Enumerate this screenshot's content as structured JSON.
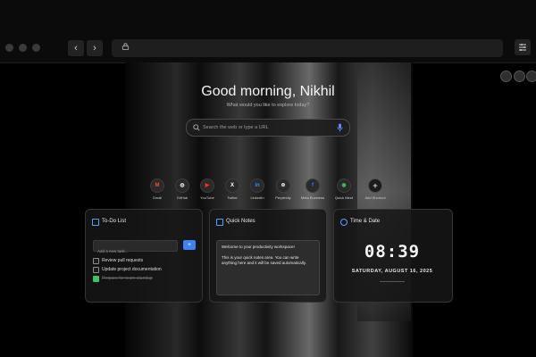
{
  "browser": {
    "back_icon": "chevron-left-icon",
    "forward_icon": "chevron-right-icon",
    "url_value": "",
    "lock_icon": "lock-icon",
    "menu_icon": "sliders-icon"
  },
  "top_right_icons": [
    "settings-icon",
    "globe-icon",
    "refresh-icon"
  ],
  "hero": {
    "greeting": "Good morning, Nikhil",
    "subtitle": "What would you like to explore today?"
  },
  "search": {
    "placeholder": "Search the web or type a URL",
    "icon": "search-icon",
    "mic_icon": "mic-icon",
    "accent": "#5a8dff"
  },
  "shortcuts": [
    {
      "label": "Gmail",
      "glyph": "M",
      "color": "#e84b3c"
    },
    {
      "label": "GitHub",
      "glyph": "◍",
      "color": "#d8d8d8"
    },
    {
      "label": "YouTube",
      "glyph": "▶",
      "color": "#ff2a2a"
    },
    {
      "label": "Twitter",
      "glyph": "X",
      "color": "#ffffff"
    },
    {
      "label": "LinkedIn",
      "glyph": "in",
      "color": "#2e8cff"
    },
    {
      "label": "Perplexity",
      "glyph": "⊛",
      "color": "#dcdcdc"
    },
    {
      "label": "Meta Business",
      "glyph": "f",
      "color": "#3b74ff"
    },
    {
      "label": "Quick Meet",
      "glyph": "◉",
      "color": "#3bbf62"
    },
    {
      "label": "Add Shortcut",
      "glyph": "+",
      "color": "#d0d0d0"
    }
  ],
  "todo": {
    "title": "To-Do List",
    "input_placeholder": "Add a new task...",
    "add_label": "+",
    "items": [
      {
        "text": "Review pull requests",
        "done": false
      },
      {
        "text": "Update project documentation",
        "done": false
      },
      {
        "text": "Prepare for team standup",
        "done": true
      }
    ]
  },
  "notes": {
    "title": "Quick Notes",
    "text1": "Welcome to your productivity workspace!",
    "text2": "This is your quick notes area. You can write anything here and it will be saved automatically."
  },
  "datetime": {
    "title": "Time & Date",
    "time": "08:39",
    "date": "SATURDAY, AUGUST 16, 2025"
  }
}
